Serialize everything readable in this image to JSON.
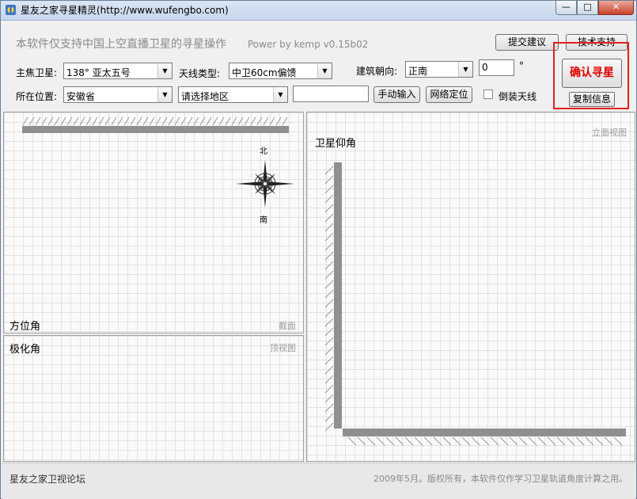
{
  "window": {
    "title": "星友之家寻星精灵(http://www.wufengbo.com)",
    "minimize_label": "—",
    "maximize_label": "□",
    "close_label": "✕"
  },
  "header": {
    "notice": "本软件仅支持中国上空直播卫星的寻星操作",
    "power": "Power by kemp  v0.15b02",
    "submit_suggestion": "提交建议",
    "tech_support": "技术支持"
  },
  "form": {
    "satellite_label": "主焦卫星:",
    "satellite_value": "138°   亚太五号",
    "antenna_label": "天线类型:",
    "antenna_value": "中卫60cm偏馈",
    "orientation_label": "建筑朝向:",
    "orientation_value": "正南",
    "angle_value": "0",
    "degree_symbol": "°",
    "location_label": "所在位置:",
    "province_value": "安徽省",
    "region_value": "请选择地区",
    "manual_input": "手动输入",
    "network_locate": "网络定位",
    "invert_antenna": "倒装天线",
    "invert_checked": false
  },
  "actions": {
    "confirm": "确认寻星",
    "copy_info": "复制信息"
  },
  "panels": {
    "azimuth_title": "方位角",
    "azimuth_sub": "截面",
    "compass_north": "北",
    "compass_south": "南",
    "polar_title": "极化角",
    "polar_sub": "顶视图",
    "elevation_title": "卫星仰角",
    "elevation_sub": "立面视图"
  },
  "status": {
    "forum": "星友之家卫视论坛",
    "copyright": "2009年5月。版权所有，本软件仅作学习卫星轨道角度计算之用。"
  }
}
